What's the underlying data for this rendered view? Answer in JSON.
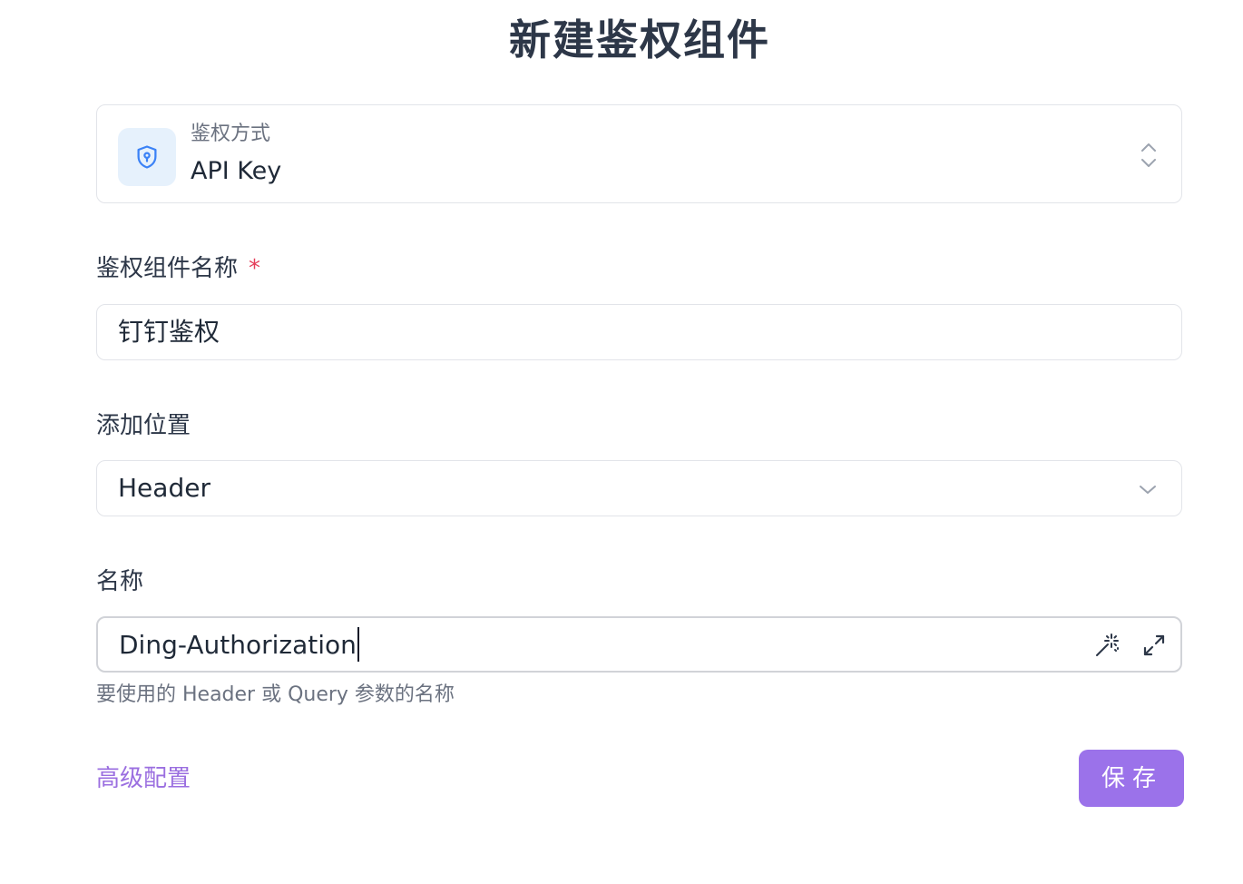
{
  "page": {
    "title": "新建鉴权组件"
  },
  "auth_method": {
    "label": "鉴权方式",
    "value": "API Key",
    "icon": "shield-keyhole-icon",
    "icon_color": "#3b82f6"
  },
  "component_name": {
    "label": "鉴权组件名称",
    "required_mark": "*",
    "value": "钉钉鉴权"
  },
  "location": {
    "label": "添加位置",
    "value": "Header"
  },
  "name_field": {
    "label": "名称",
    "value": "Ding-Authorization",
    "helper": "要使用的 Header 或 Query 参数的名称",
    "icons": [
      "magic-wand-icon",
      "expand-icon"
    ]
  },
  "footer": {
    "advanced_label": "高级配置",
    "save_label": "保存"
  },
  "colors": {
    "accent": "#9b72ea",
    "link": "#9b6fe0",
    "required": "#e53e5a",
    "border": "#e2e4e9"
  }
}
